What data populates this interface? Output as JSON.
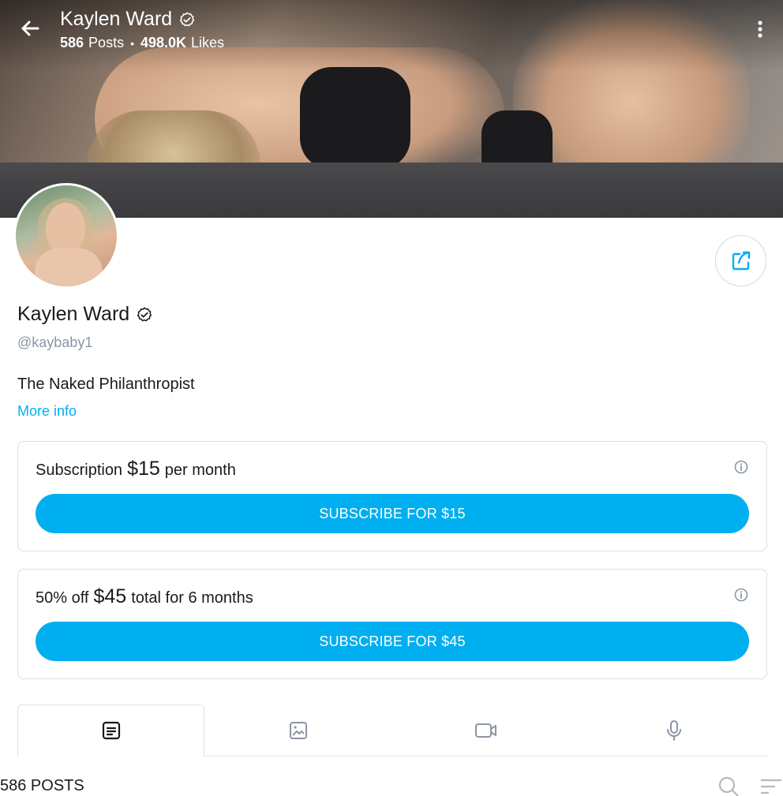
{
  "header": {
    "title": "Kaylen Ward",
    "posts_count": "586",
    "posts_label": "Posts",
    "separator": "•",
    "likes_count": "498.0K",
    "likes_label": "Likes"
  },
  "profile": {
    "name": "Kaylen Ward",
    "handle": "@kaybaby1",
    "bio": "The Naked Philanthropist",
    "more_info": "More info",
    "verified": true
  },
  "subscriptions": [
    {
      "prefix": "Subscription",
      "price": "$15",
      "suffix": "per month",
      "button_label": "SUBSCRIBE FOR $15"
    },
    {
      "prefix": "50% off",
      "price": "$45",
      "suffix": "total for 6 months",
      "button_label": "SUBSCRIBE FOR $45"
    }
  ],
  "tabs": [
    {
      "icon": "posts-icon",
      "active": true
    },
    {
      "icon": "photo-icon",
      "active": false
    },
    {
      "icon": "video-icon",
      "active": false
    },
    {
      "icon": "microphone-icon",
      "active": false
    }
  ],
  "feed": {
    "count_label": "586 POSTS"
  },
  "colors": {
    "accent": "#00aff0",
    "text": "#1a1a1a",
    "muted": "#8a96a3",
    "border": "#dcdfe2",
    "icon_gray": "#8a96a3"
  }
}
